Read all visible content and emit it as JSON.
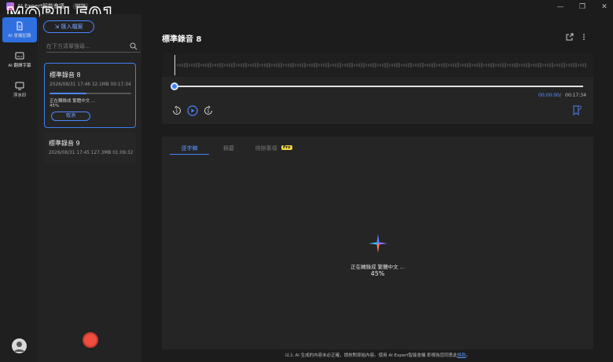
{
  "titlebar": {
    "app_title": "AI Expert智能會議",
    "beta": "BETA",
    "minimize": "—",
    "maximize": "❐",
    "close": "✕",
    "watermark": "MOBILE01"
  },
  "rail": {
    "items": [
      {
        "label": "AI 會議記錄",
        "icon": "document-icon"
      },
      {
        "label": "AI 翻譯字幕",
        "icon": "subtitle-icon"
      },
      {
        "label": "浮水印",
        "icon": "monitor-icon"
      }
    ]
  },
  "list": {
    "import_label": "匯入檔案",
    "search_placeholder": "在下方清單搜尋...",
    "recordings": [
      {
        "title": "標準錄音 8",
        "meta": "2026/08/31 17:46 32.1MB   00:17:34",
        "status": "正在轉錄成 繁體中文 ...",
        "percent": "45%",
        "progress": 0.45,
        "cancel": "取消"
      },
      {
        "title": "標準錄音 9",
        "meta": "2026/08/31 17:45 127.3MB 01:09:32"
      }
    ]
  },
  "main": {
    "title": "標準錄音 8",
    "player": {
      "current_time": "00:00:00",
      "separator": "/",
      "total_time": "00:17:34"
    },
    "tabs": [
      {
        "label": "逐字稿"
      },
      {
        "label": "摘要"
      },
      {
        "label": "待辦事項"
      }
    ],
    "pro_badge": "Pro",
    "status_text": "正在轉錄成 繁體中文 ...",
    "status_percent": "45%"
  },
  "footer": {
    "text": "以上 AI 生成的內容未必正確，請核對原始內容。使用 AI Expert智能會議 即視為您同意此",
    "link": "條款",
    "end": "。"
  },
  "colors": {
    "accent": "#3d7ff5",
    "record": "#ee4d3f",
    "pro": "#f2d640"
  }
}
